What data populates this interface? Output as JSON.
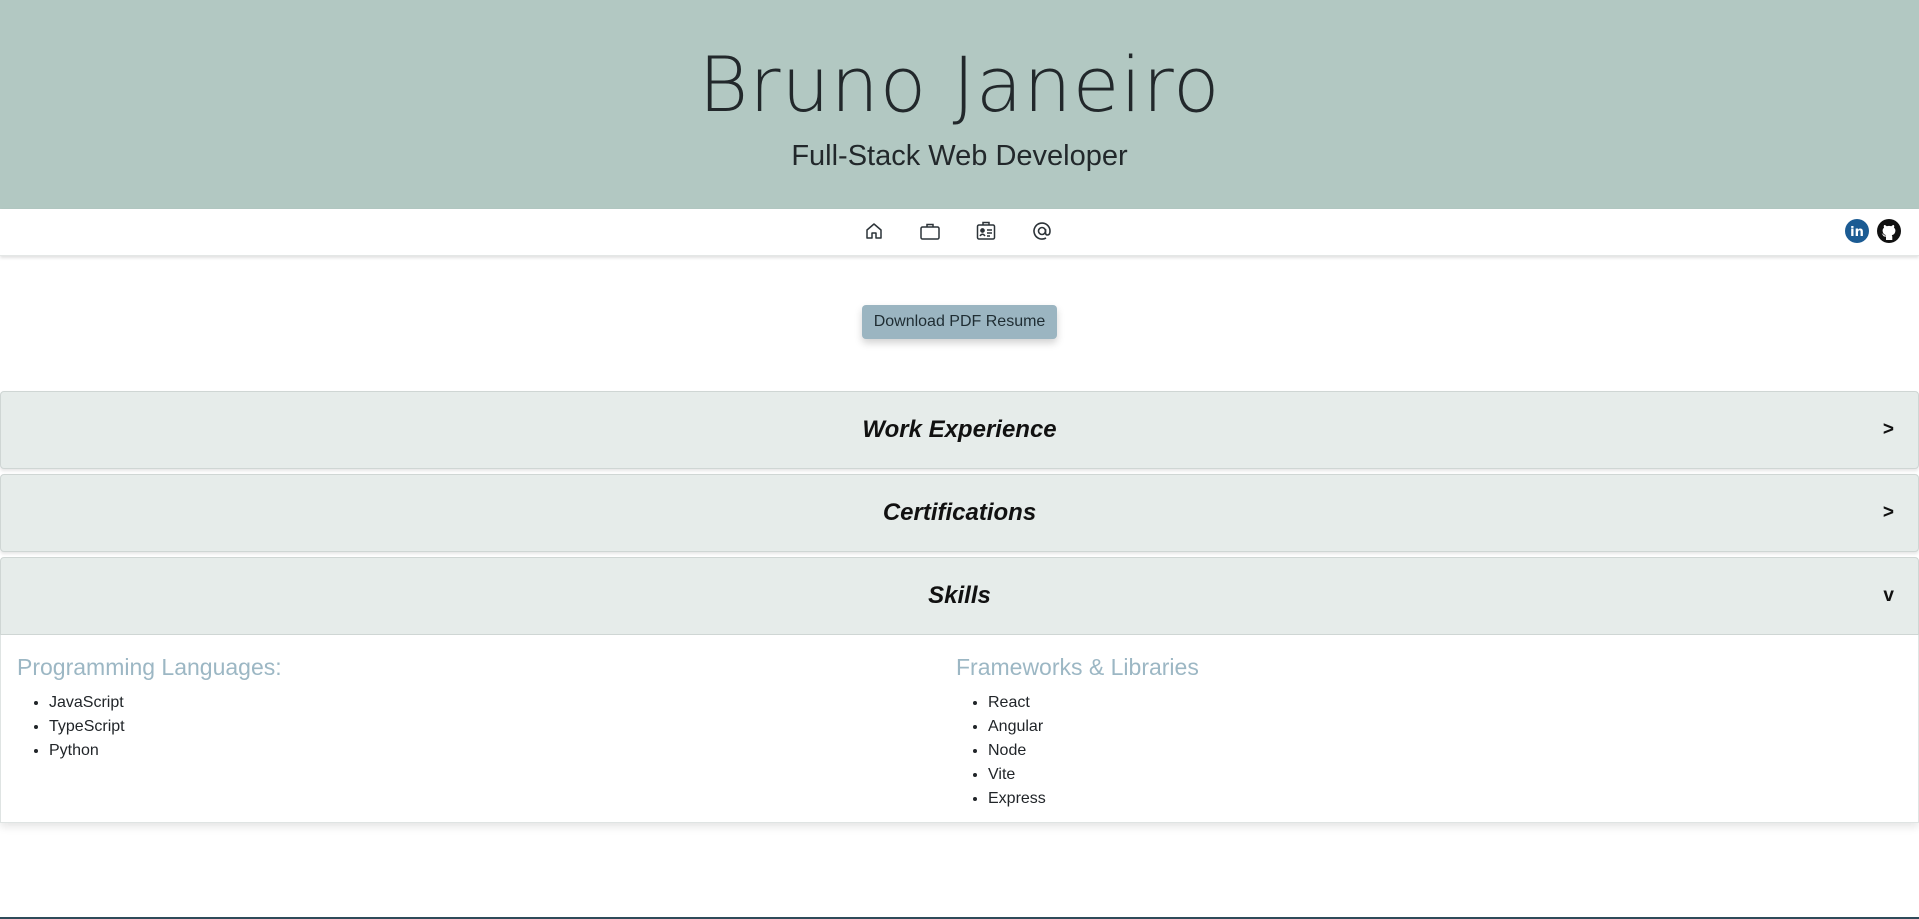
{
  "header": {
    "name": "Bruno Janeiro",
    "title": "Full-Stack Web Developer",
    "background_color": "#b2c8c2"
  },
  "nav": {
    "icons": [
      {
        "name": "home-icon"
      },
      {
        "name": "briefcase-icon"
      },
      {
        "name": "resume-card-icon"
      },
      {
        "name": "at-sign-icon"
      }
    ],
    "social": [
      {
        "name": "linkedin-icon",
        "label": "in",
        "color": "#1b5b93"
      },
      {
        "name": "github-icon",
        "color": "#111111"
      }
    ]
  },
  "download": {
    "label": "Download PDF Resume",
    "color": "#9bb5c1"
  },
  "accordion": [
    {
      "title": "Work Experience",
      "caret": ">",
      "open": false
    },
    {
      "title": "Certifications",
      "caret": ">",
      "open": false
    },
    {
      "title": "Skills",
      "caret": "v",
      "open": true
    }
  ],
  "skills": {
    "programming": {
      "heading": "Programming Languages:",
      "items": [
        "JavaScript",
        "TypeScript",
        "Python"
      ]
    },
    "frameworks": {
      "heading": "Frameworks & Libraries",
      "items": [
        "React",
        "Angular",
        "Node",
        "Vite",
        "Express"
      ]
    },
    "heading_color": "#9cb7c4"
  }
}
